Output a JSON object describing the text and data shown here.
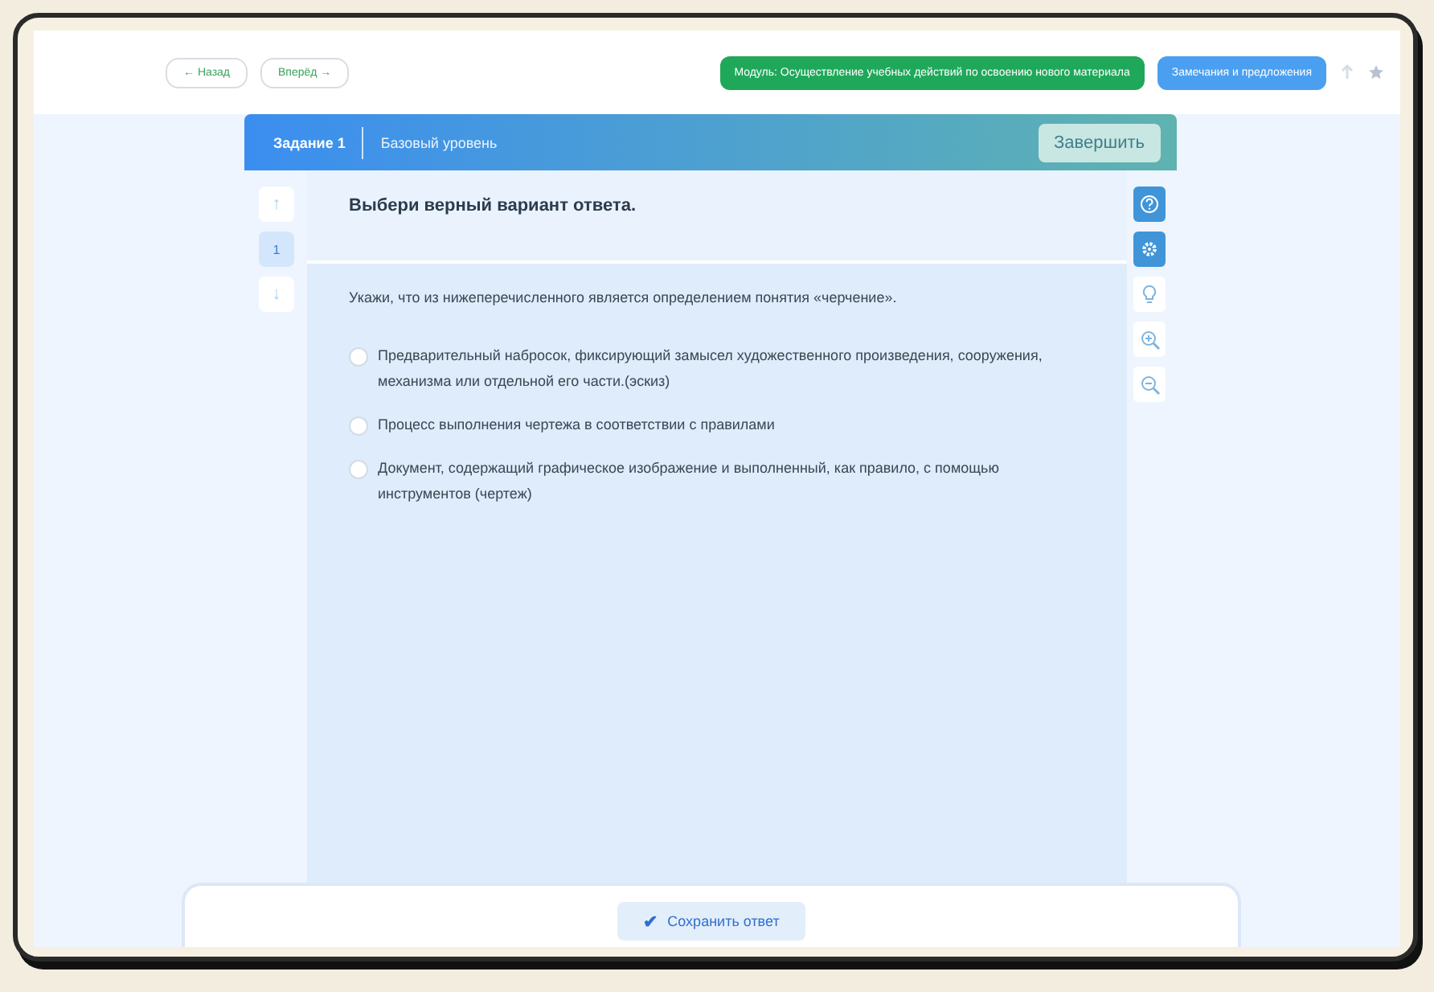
{
  "top_bar": {
    "back_label": "← Назад",
    "forward_label": "Вперёд →",
    "module_badge": "Модуль: Осуществление учебных действий по освоению нового материала",
    "feedback_button": "Замечания и предложения"
  },
  "task_header": {
    "task": "Задание 1",
    "level": "Базовый уровень",
    "finish_button": "Завершить"
  },
  "question_nav": {
    "up": "↑",
    "down": "↓",
    "items": [
      {
        "label": "1",
        "selected": true
      }
    ]
  },
  "question": {
    "title": "Выбери верный вариант ответа.",
    "prompt": "Укажи, что из нижеперечисленного является определением понятия «черчение».",
    "options": [
      {
        "text": "Предварительный набросок, фиксирующий замысел художественного произведения, сооружения, механизма или отдельной его части.(эскиз)",
        "selected": false
      },
      {
        "text": "Процесс выполнения чертежа в соответствии с правилами",
        "selected": false
      },
      {
        "text": "Документ, содержащий графическое изображение и выполненный, как правило, с помощью инструментов (чертеж)",
        "selected": false
      }
    ]
  },
  "tools": [
    {
      "kind": "help",
      "active": true
    },
    {
      "kind": "settings",
      "active": true
    },
    {
      "kind": "hint",
      "active": false
    },
    {
      "kind": "zoom-in",
      "active": false
    },
    {
      "kind": "zoom-out",
      "active": false
    }
  ],
  "save_button": {
    "icon": "✔",
    "label": "Сохранить ответ"
  }
}
